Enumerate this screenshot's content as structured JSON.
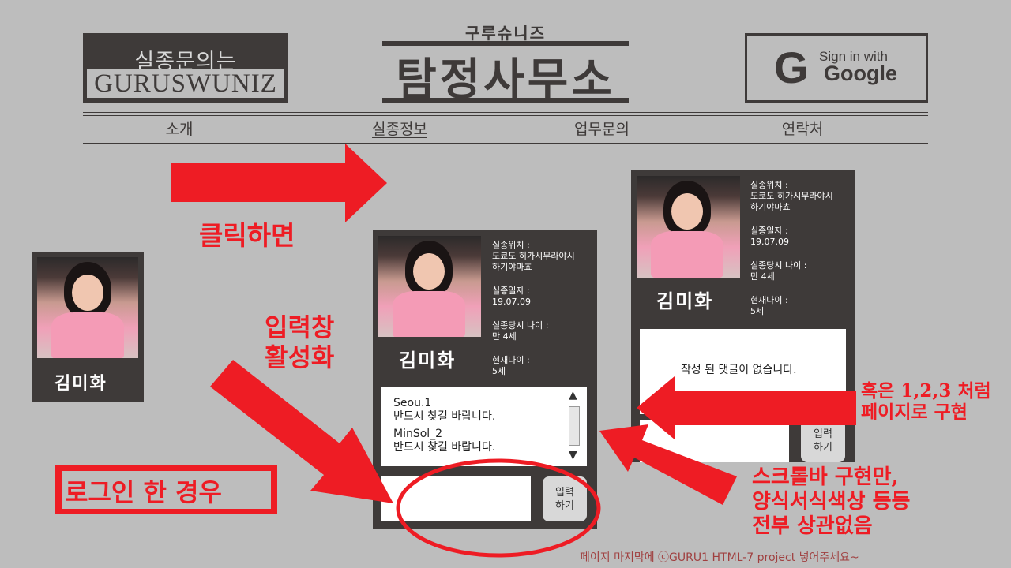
{
  "header": {
    "logo_line1": "실종문의는",
    "logo_line2": "GURUSWUNIZ",
    "center_sub": "구루슈니즈",
    "center_title": "탐정사무소",
    "google_icon": "G",
    "google_line1": "Sign in with",
    "google_line2": "Google"
  },
  "nav": {
    "items": [
      {
        "label": "소개"
      },
      {
        "label": "실종정보"
      },
      {
        "label": "업무문의"
      },
      {
        "label": "연락처"
      }
    ]
  },
  "annotations": {
    "click_label": "클릭하면",
    "input_active": "입력창\n활성화",
    "login_case": "로그인 한 경우",
    "paging_note": "혹은 1,2,3 처럼\n페이지로 구현",
    "scroll_note": "스크롤바 구현만,\n양식서식색상 등등\n전부 상관없음",
    "colors": {
      "red": "#ee1c24",
      "card": "#3e3a39",
      "bg": "#bdbdbd"
    }
  },
  "small_card": {
    "name": "김미화"
  },
  "detail_card": {
    "name": "김미화",
    "location_label": "실종위치 :",
    "location_value": "도쿄도 히가시무라야시\n하기야마쵸",
    "date_label": "실종일자 :",
    "date_value": "19.07.09",
    "age_label": "실종당시 나이 :",
    "age_value": "만 4세",
    "current_label": "현재나이 :",
    "current_value": "5세",
    "comments": [
      {
        "user": "Seou.1",
        "text": "반드시 찾길 바랍니다."
      },
      {
        "user": "MinSol_2",
        "text": "반드시 찾길 바랍니다."
      }
    ],
    "input_button": "입력\n하기",
    "scroll_up": "▲",
    "scroll_down": "▼"
  },
  "empty_card": {
    "name": "김미화",
    "location_label": "실종위치 :",
    "location_value": "도쿄도 히가시무라야시\n하기야마쵸",
    "date_label": "실종일자 :",
    "date_value": "19.07.09",
    "age_label": "실종당시 나이 :",
    "age_value": "만 4세",
    "current_label": "현재나이 :",
    "current_value": "5세",
    "no_comments": "작성 된 댓글이 없습니다.",
    "input_button": "입력\n하기"
  },
  "footer": "페이지 마지막에 ⓒGURU1 HTML-7 project 넣어주세요~"
}
